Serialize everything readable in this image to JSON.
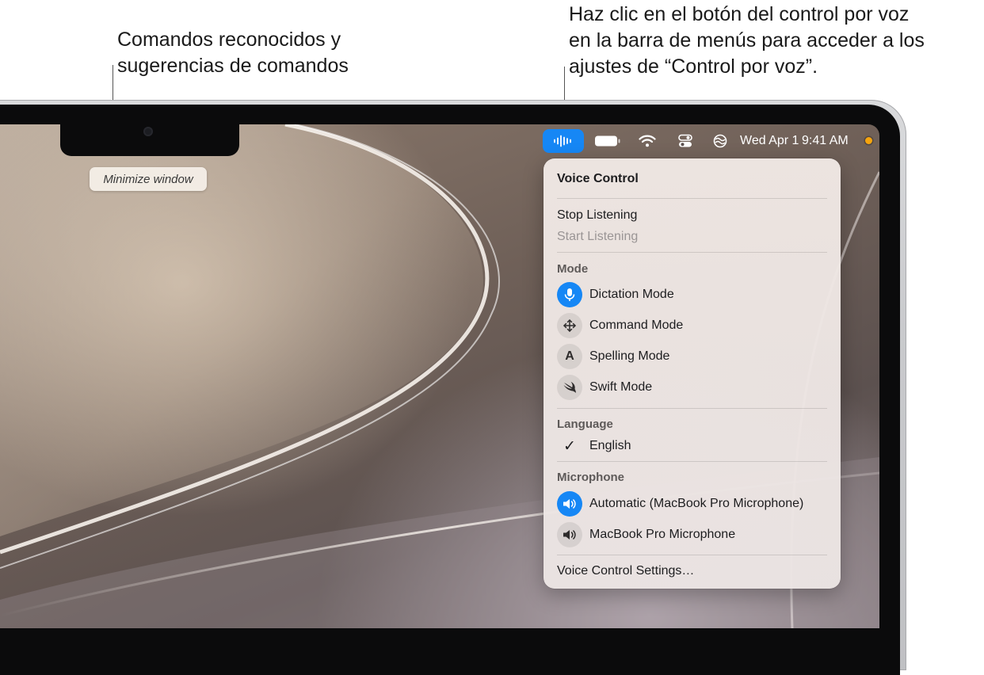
{
  "callouts": {
    "left": "Comandos reconocidos y\nsugerencias de comandos",
    "right": "Haz clic en el botón del control por voz\nen la barra de menús para acceder a los\najustes de “Control por voz”."
  },
  "menubar": {
    "icons": [
      "voice-control-icon",
      "battery-icon",
      "wifi-icon",
      "control-center-icon",
      "voice-control-status-icon"
    ],
    "date": "Wed Apr 1",
    "time": "9:41 AM",
    "accent_color": "#1687f5",
    "mic_indicator_color": "#f6a40d"
  },
  "command_bubble": {
    "text": "Minimize window"
  },
  "voice_menu": {
    "title": "Voice Control",
    "stop_listening": "Stop Listening",
    "start_listening": "Start Listening",
    "mode_heading": "Mode",
    "modes": [
      {
        "label": "Dictation Mode",
        "icon": "microphone-icon",
        "active": true
      },
      {
        "label": "Command Mode",
        "icon": "move-arrows-icon",
        "active": false
      },
      {
        "label": "Spelling Mode",
        "icon": "letter-a-icon",
        "glyph": "A",
        "active": false
      },
      {
        "label": "Swift Mode",
        "icon": "swift-icon",
        "active": false
      }
    ],
    "language_heading": "Language",
    "language": "English",
    "microphone_heading": "Microphone",
    "microphones": [
      {
        "label": "Automatic (MacBook Pro Microphone)",
        "icon": "speaker-icon",
        "active": true
      },
      {
        "label": "MacBook Pro Microphone",
        "icon": "speaker-icon",
        "active": false
      }
    ],
    "settings": "Voice Control Settings…"
  }
}
